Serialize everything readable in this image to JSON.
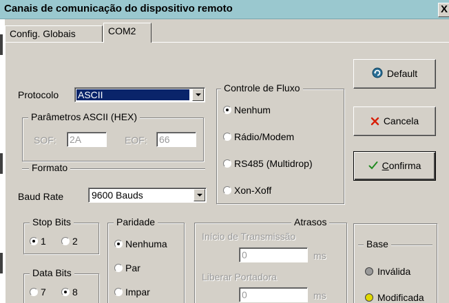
{
  "window": {
    "title": "Canais de comunicação do dispositivo remoto",
    "close_glyph": "X"
  },
  "tabs": [
    {
      "label": "Config. Globais",
      "active": false
    },
    {
      "label": "COM2",
      "active": true
    }
  ],
  "protocolo": {
    "label": "Protocolo",
    "value": "ASCII"
  },
  "ascii_params": {
    "title": "Parâmetros ASCII (HEX)",
    "sof_label": "SOF:",
    "sof_value": "2A",
    "eof_label": "EOF:",
    "eof_value": "66"
  },
  "formato": {
    "title": "Formato",
    "baud_label": "Baud Rate",
    "baud_value": "9600 Bauds"
  },
  "controle_fluxo": {
    "title": "Controle de Fluxo",
    "options": [
      "Nenhum",
      "Rádio/Modem",
      "RS485 (Multidrop)",
      "Xon-Xoff"
    ],
    "selected": "Nenhum"
  },
  "stop_bits": {
    "title": "Stop Bits",
    "options": [
      "1",
      "2"
    ],
    "selected": "1"
  },
  "data_bits": {
    "title": "Data Bits",
    "options": [
      "7",
      "8"
    ],
    "selected": "8"
  },
  "paridade": {
    "title": "Paridade",
    "options": [
      "Nenhuma",
      "Par",
      "Impar"
    ],
    "selected": "Nenhuma"
  },
  "atrasos": {
    "title": "Atrasos",
    "inicio_label": "Início de Transmissão",
    "inicio_value": "0",
    "inicio_unit": "ms",
    "liberar_label": "Liberar Portadora",
    "liberar_value": "0",
    "liberar_unit": "ms"
  },
  "buttons": {
    "default_label": "Default",
    "cancela_label": "Cancela",
    "confirma_prefix": "C",
    "confirma_rest": "onfirma"
  },
  "base": {
    "title": "Base",
    "invalida_label": "Inválida",
    "modificada_label": "Modificada",
    "invalida_color": "#9a9a9a",
    "modificada_color": "#e0d800"
  },
  "colors": {
    "titlebar": "#9ac8cf",
    "dialog": "#d4d0c8",
    "selection": "#0a246a",
    "cancel_icon": "#d81e06",
    "confirm_icon": "#1f8a1f"
  }
}
